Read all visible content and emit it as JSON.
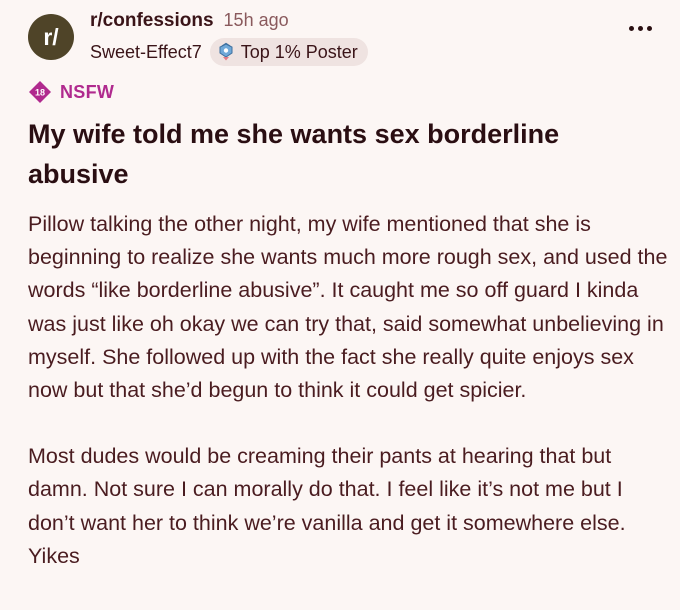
{
  "post": {
    "subreddit": "r/confessions",
    "time_ago": "15h ago",
    "author": "Sweet-Effect7",
    "flair": "Top 1% Poster",
    "nsfw_badge": "18",
    "nsfw_label": "NSFW",
    "title": "My wife told me she wants sex borderline abusive",
    "paragraphs": [
      "Pillow talking the other night, my wife mentioned that she is beginning to realize she wants much more rough sex, and used the words “like borderline abusive”. It caught me so off guard I kinda was just like oh okay we can try that, said somewhat unbelieving in myself. She followed up with the fact she really quite enjoys sex now but that she’d begun to think it could get spicier.",
      "Most dudes would be creaming their pants at hearing that but damn. Not sure I can morally do that. I feel like it’s not me but I don’t want her to think we’re vanilla and get it somewhere else. Yikes"
    ]
  },
  "icons": {
    "avatar": "subreddit-avatar-icon",
    "flair": "top-poster-badge-icon",
    "more": "more-options-icon",
    "nsfw": "nsfw-badge-icon"
  },
  "colors": {
    "background": "#fcf6f4",
    "nsfw": "#b02a8e",
    "avatar_bg": "#4f4428"
  }
}
